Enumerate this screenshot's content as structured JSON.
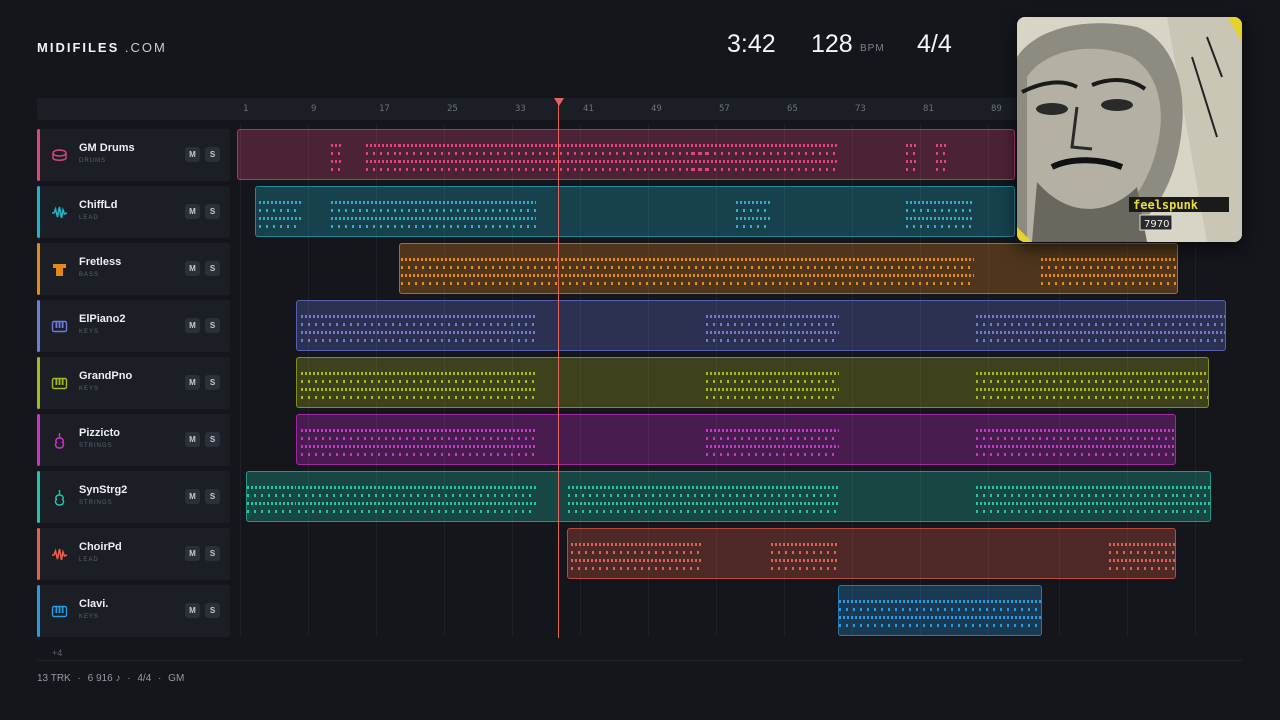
{
  "brand": {
    "bold": "MIDIFILES",
    "light": ".COM"
  },
  "header": {
    "time": "3:42",
    "bpm": "128",
    "bpm_unit": "BPM",
    "signature": "4/4"
  },
  "ruler": {
    "bars": [
      "1",
      "9",
      "17",
      "25",
      "33",
      "41",
      "49",
      "57",
      "65",
      "73",
      "81",
      "89"
    ]
  },
  "tracks": [
    {
      "name": "GM Drums",
      "type": "DRUMS",
      "color": "#e0457e",
      "icon": "drum-icon",
      "mute": "M",
      "solo": "S"
    },
    {
      "name": "ChiffLd",
      "type": "LEAD",
      "color": "#1fb4c9",
      "icon": "waveform-icon",
      "mute": "M",
      "solo": "S"
    },
    {
      "name": "Fretless",
      "type": "BASS",
      "color": "#e58a1a",
      "icon": "bass-icon",
      "mute": "M",
      "solo": "S"
    },
    {
      "name": "ElPiano2",
      "type": "KEYS",
      "color": "#6d7be0",
      "icon": "piano-icon",
      "mute": "M",
      "solo": "S"
    },
    {
      "name": "GrandPno",
      "type": "KEYS",
      "color": "#a8b820",
      "icon": "piano-icon",
      "mute": "M",
      "solo": "S"
    },
    {
      "name": "Pizzicto",
      "type": "STRINGS",
      "color": "#d12fcf",
      "icon": "violin-icon",
      "mute": "M",
      "solo": "S"
    },
    {
      "name": "SynStrg2",
      "type": "STRINGS",
      "color": "#25c4a5",
      "icon": "violin-icon",
      "mute": "M",
      "solo": "S"
    },
    {
      "name": "ChoirPd",
      "type": "LEAD",
      "color": "#ea5f47",
      "icon": "waveform-icon",
      "mute": "M",
      "solo": "S"
    },
    {
      "name": "Clavi.",
      "type": "KEYS",
      "color": "#2a9be3",
      "icon": "piano-icon",
      "mute": "M",
      "solo": "S"
    }
  ],
  "more_tracks": "+4",
  "footer": {
    "tracks": "13 TRK",
    "notes": "6 916 ♪",
    "signature": "4/4",
    "standard": "GM",
    "sep": "·"
  },
  "cover": {
    "text": "feelspunk",
    "year": "7970"
  }
}
